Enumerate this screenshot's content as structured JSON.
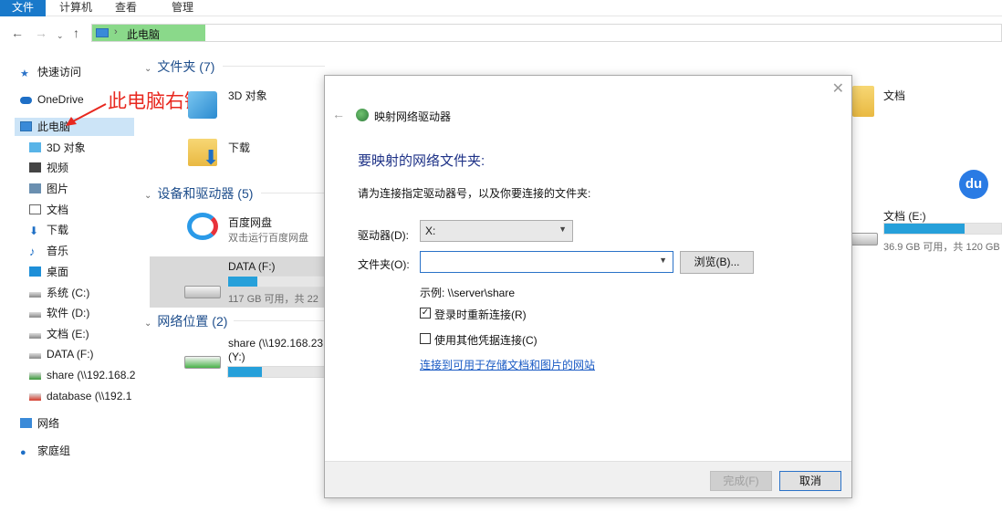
{
  "ribbon": {
    "tabs": [
      "文件",
      "计算机",
      "查看",
      "管理"
    ]
  },
  "address": {
    "path": "此电脑"
  },
  "annotation": {
    "text": "此电脑右键"
  },
  "sidebar": {
    "items": [
      {
        "label": "快速访问",
        "icon": "star-icon"
      },
      {
        "label": "OneDrive",
        "icon": "cloud-icon"
      },
      {
        "label": "此电脑",
        "icon": "computer-icon"
      },
      {
        "label": "3D 对象",
        "icon": "cube-icon"
      },
      {
        "label": "视频",
        "icon": "video-icon"
      },
      {
        "label": "图片",
        "icon": "picture-icon"
      },
      {
        "label": "文档",
        "icon": "document-icon"
      },
      {
        "label": "下载",
        "icon": "download-icon"
      },
      {
        "label": "音乐",
        "icon": "music-icon"
      },
      {
        "label": "桌面",
        "icon": "desktop-icon"
      },
      {
        "label": "系统 (C:)",
        "icon": "drive-icon"
      },
      {
        "label": "软件 (D:)",
        "icon": "drive-icon"
      },
      {
        "label": "文档 (E:)",
        "icon": "drive-icon"
      },
      {
        "label": "DATA (F:)",
        "icon": "drive-icon"
      },
      {
        "label": "share (\\\\192.168.2",
        "icon": "network-drive-icon"
      },
      {
        "label": "database (\\\\192.1",
        "icon": "disconnected-drive-icon"
      },
      {
        "label": "网络",
        "icon": "network-icon"
      },
      {
        "label": "家庭组",
        "icon": "homegroup-icon"
      }
    ]
  },
  "main": {
    "folders_header": "文件夹 (7)",
    "devices_header": "设备和驱动器 (5)",
    "network_header": "网络位置 (2)",
    "folders": [
      {
        "name": "3D 对象"
      },
      {
        "name": "下载"
      },
      {
        "name": "文档"
      }
    ],
    "devices": [
      {
        "name": "百度网盘",
        "sub": "双击运行百度网盘"
      },
      {
        "name": "DATA (F:)",
        "sub": "117 GB 可用，共 22",
        "used": 0.3
      },
      {
        "name": "文档 (E:)",
        "sub": "36.9 GB 可用，共 120 GB",
        "used": 0.69
      }
    ],
    "network": [
      {
        "name": "share (\\\\192.168.23",
        "name2": "(Y:)",
        "used": 0.35
      }
    ]
  },
  "badge": {
    "text": "du"
  },
  "dialog": {
    "title": "映射网络驱动器",
    "heading": "要映射的网络文件夹:",
    "instruction": "请为连接指定驱动器号，以及你要连接的文件夹:",
    "drive_label": "驱动器(D):",
    "drive_value": "X:",
    "folder_label": "文件夹(O):",
    "folder_value": "",
    "browse_label": "浏览(B)...",
    "example": "示例: \\\\server\\share",
    "reconnect_label": "登录时重新连接(R)",
    "reconnect_checked": "✓",
    "other_creds_label": "使用其他凭据连接(C)",
    "link_text": "连接到可用于存储文档和图片的网站",
    "finish_label": "完成(F)",
    "cancel_label": "取消"
  }
}
